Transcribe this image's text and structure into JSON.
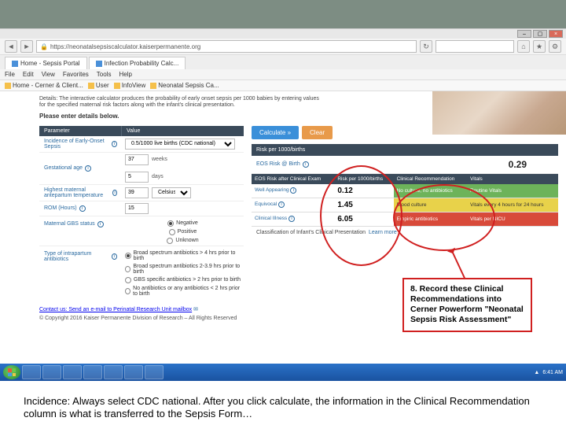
{
  "topbar": {},
  "browser": {
    "address": "https://neonatalsepsiscalculator.kaiserpermanente.org",
    "search_placeholder": "",
    "reload": "↻",
    "tabs": [
      {
        "label": "Home - Sepsis Portal"
      },
      {
        "label": "Infection Probability Calc..."
      }
    ],
    "menu": [
      "File",
      "Edit",
      "View",
      "Favorites",
      "Tools",
      "Help"
    ],
    "bookmarks": [
      "Home - Cerner & Client...",
      "User",
      "InfoView",
      "Neonatal Sepsis Ca..."
    ]
  },
  "page": {
    "intro": "Details: The interactive calculator produces the probability of early onset sepsis per 1000 babies by entering values for the specified maternal risk factors along with the infant's clinical presentation.",
    "prompt": "Please enter details below.",
    "form": {
      "head_param": "Parameter",
      "head_val": "Value",
      "rows": {
        "incidence_label": "Incidence of Early-Onset Sepsis",
        "incidence_val": "0.5/1000 live births (CDC national)",
        "gest_label": "Gestational age",
        "gest_weeks": "37",
        "gest_weeks_unit": "weeks",
        "gest_days": "5",
        "gest_days_unit": "days",
        "temp_label": "Highest maternal antepartum temperature",
        "temp_val": "39",
        "temp_unit": "Celsius",
        "rom_label": "ROM (Hours)",
        "rom_val": "15",
        "gbs_label": "Maternal GBS status",
        "gbs_opts": [
          "Negative",
          "Positive",
          "Unknown"
        ],
        "abx_label": "Type of intrapartum antibiotics",
        "abx_opts": [
          "Broad spectrum antibiotics > 4 hrs prior to birth",
          "Broad spectrum antibiotics 2-3.9 hrs prior to birth",
          "GBS specific antibiotics > 2 hrs prior to birth",
          "No antibiotics or any antibiotics < 2 hrs prior to birth"
        ]
      }
    },
    "buttons": {
      "calc": "Calculate »",
      "clear": "Clear"
    },
    "risk_head": "Risk per 1000/births",
    "risk_rows": {
      "eos_label": "EOS Risk @ Birth",
      "eos_val": "0.29"
    },
    "exam_table": {
      "head": [
        "EOS Risk after Clinical Exam",
        "Risk per 1000/births",
        "Clinical Recommendation",
        "Vitals"
      ],
      "rows": [
        {
          "lbl": "Well Appearing",
          "risk": "0.12",
          "rec": "No culture, no antibiotics",
          "recClass": "g",
          "vit": "Routine Vitals",
          "vitClass": "g"
        },
        {
          "lbl": "Equivocal",
          "risk": "1.45",
          "rec": "Blood culture",
          "recClass": "y",
          "vit": "Vitals every 4 hours for 24 hours",
          "vitClass": "y"
        },
        {
          "lbl": "Clinical Illness",
          "risk": "6.05",
          "rec": "Empiric antibiotics",
          "recClass": "r",
          "vit": "Vitals per NICU",
          "vitClass": "r"
        }
      ]
    },
    "classif_label": "Classification of Infant's Clinical Presentation",
    "classif_link": "Learn more",
    "contact": "Contact us: Send an e-mail to Perinatal Research Unit mailbox",
    "contact_icon": "✉",
    "copyright": "© Copyright 2016 Kaiser Permanente Division of Research – All Rights Reserved"
  },
  "annotation": {
    "callout": "8. Record these Clinical Recommendations into Cerner Powerform \"Neonatal Sepsis Risk Assessment\""
  },
  "taskbar": {
    "time": "6:41 AM"
  },
  "bottom": "Incidence: Always select CDC national. After you click calculate, the information in the Clinical Recommendation column is what is transferred to the Sepsis Form…"
}
